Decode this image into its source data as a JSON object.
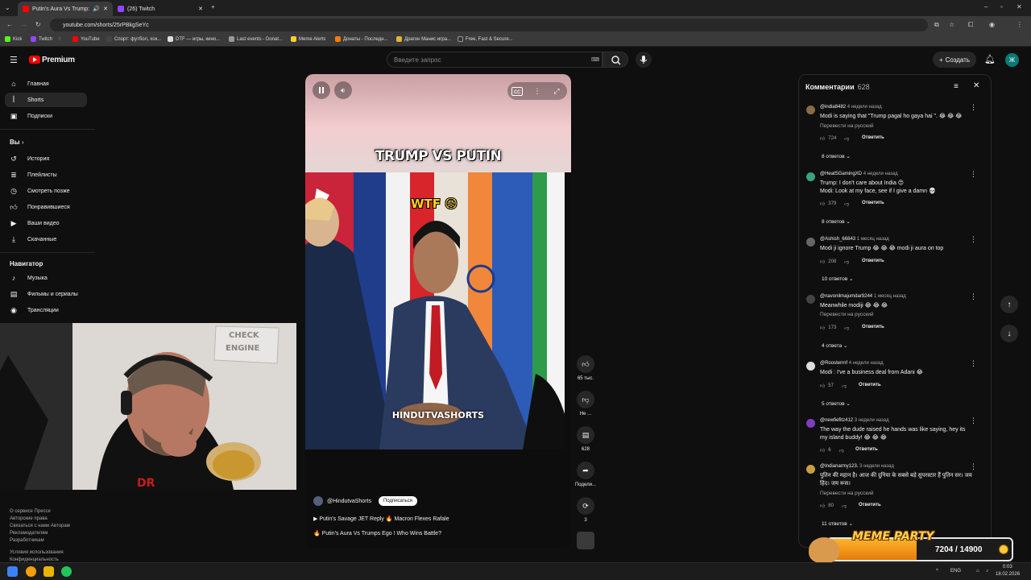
{
  "browser": {
    "tabs": [
      {
        "title": "Putin's Aura Vs Trump:",
        "color": "#ff0000"
      },
      {
        "title": "(26) Twitch",
        "color": "#9146ff"
      }
    ],
    "url": "youtube.com/shorts/25rPBkgSeYc",
    "bookmarks": [
      "Kick",
      "Twitch",
      "YouTube",
      "Спорт: футбол, хок...",
      "DTF — игры, кино...",
      "Last events - Donat...",
      "Meme Alerts",
      "Донаты - Последн...",
      "Драгон Манис игра...",
      "Free, Fast & Secure..."
    ]
  },
  "header": {
    "logo": "Premium",
    "search_placeholder": "Введите запрос",
    "create": "Создать",
    "avatar_letter": "Ж"
  },
  "sidebar": {
    "main": [
      {
        "label": "Главная",
        "icon": "home-icon"
      },
      {
        "label": "Shorts",
        "icon": "shorts-icon"
      },
      {
        "label": "Подписки",
        "icon": "subscriptions-icon"
      }
    ],
    "you_heading": "Вы",
    "you": [
      {
        "label": "История",
        "icon": "history-icon"
      },
      {
        "label": "Плейлисты",
        "icon": "playlist-icon"
      },
      {
        "label": "Смотреть позже",
        "icon": "clock-icon"
      },
      {
        "label": "Понравившиеся",
        "icon": "like-icon"
      },
      {
        "label": "Ваши видео",
        "icon": "video-icon"
      },
      {
        "label": "Скачанные",
        "icon": "download-icon"
      }
    ],
    "nav_heading": "Навигатор",
    "nav": [
      {
        "label": "Музыка",
        "icon": "music-icon"
      },
      {
        "label": "Фильмы и сериалы",
        "icon": "film-icon"
      },
      {
        "label": "Трансляции",
        "icon": "live-icon"
      }
    ],
    "footer": [
      "О сервисе  Прессе",
      "Авторские права",
      "Связаться с нами  Авторам",
      "Рекламодателям",
      "Разработчикам",
      "Условия использования",
      "Конфиденциальность"
    ]
  },
  "video": {
    "title": "TRUMP VS PUTIN",
    "overlay_text": "WTF 😥",
    "watermark": "HINDUTVASHORTS",
    "channel": "@HindutvaShorts",
    "subscribe": "Подписаться",
    "playlist_lines": [
      "Putin's Savage JET Reply 🔥 Macron Flexes Rafale",
      "Putin's Aura Vs Trumps Ego ! Who Wins Battle?"
    ]
  },
  "actions": {
    "like_count": "65 тыс.",
    "dislike_label": "Не ...",
    "comments_count": "628",
    "share_label": "Подели...",
    "remix_count": "3"
  },
  "comments": {
    "title": "Комментарии",
    "count": "628",
    "items": [
      {
        "user": "@india8482",
        "time": "4 недели назад",
        "text": "Modi is saying that \"Trump pagal ho gaya hai \". 😂 😂 😂",
        "translate": "Перевести на русский",
        "likes": "724",
        "replies": "8 ответов",
        "avatar": "#8a6a4a"
      },
      {
        "user": "@HeatSGamingXD",
        "time": "4 недели назад",
        "text": "Trump: I don't care about India 😊\nModi: Look at my face, see if I give a damn 💀",
        "translate": "",
        "likes": "379",
        "replies": "8 ответов",
        "avatar": "#3aa37a"
      },
      {
        "user": "@Ashish_66843",
        "time": "1 месяц назад",
        "text": "Modi ji ignore Trump 😂 😂 😂 modi ji aura on top",
        "translate": "",
        "likes": "208",
        "replies": "10 ответов",
        "avatar": "#666666"
      },
      {
        "user": "@navonilmajumdar9244",
        "time": "1 месяц назад",
        "text": "Meanwhile modiji 😂 😂 😂",
        "translate": "Перевести на русский",
        "likes": "173",
        "replies": "4 ответа",
        "avatar": "#444444"
      },
      {
        "user": "@Roosterrnf",
        "time": "4 недели назад",
        "text": "Modi : I've a business deal from Adani 😂",
        "translate": "",
        "likes": "57",
        "replies": "5 ответов",
        "avatar": "#dddddd"
      },
      {
        "user": "@newfiefitz412",
        "time": "3 недели назад",
        "text": "The way the dude raised he hands was like saying, hey its my island buddy! 😂 😂 😂",
        "translate": "",
        "likes": "6",
        "replies": "",
        "avatar": "#7b3fc0"
      },
      {
        "user": "@Indianarmy123.",
        "time": "3 недели назад",
        "text": "पुतिन की महान है। आज की दुनिया के सबसे बड़े सुपरस्टार हैं पुतिन सर। जय हिंद। जय रूस।",
        "translate": "Перевести на русский",
        "likes": "80",
        "replies": "11 ответов",
        "avatar": "#c8a040"
      }
    ],
    "reply_label": "Ответить"
  },
  "overlay": {
    "meme_title": "MEME PARTY",
    "meme_progress": "7204 / 14900",
    "meme_fraction": 0.483
  },
  "taskbar": {
    "lang": "ENG",
    "time": "0:03",
    "date": "18.02.2026"
  }
}
